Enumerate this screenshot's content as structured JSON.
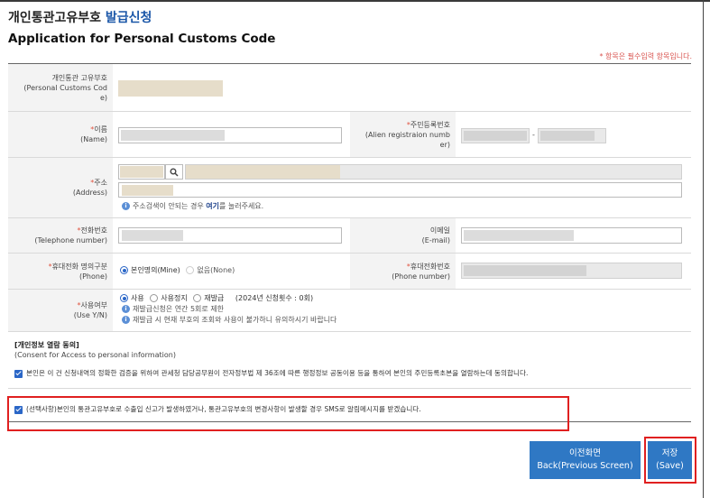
{
  "header": {
    "title_ko_plain": "개인통관고유부호",
    "title_ko_accent": "발급신청",
    "title_en": "Application for Personal Customs Code"
  },
  "required_note": "* 항목은 필수입력 항목입니다.",
  "form": {
    "customs_code": {
      "label_ko": "개인통관 고유부호",
      "label_en_1": "(Personal Customs Cod",
      "label_en_2": "e)"
    },
    "name": {
      "label_ko": "이름",
      "label_en": "(Name)"
    },
    "registration": {
      "label_ko": "주민등록번호",
      "label_en_1": "(Alien registraion numb",
      "label_en_2": "er)",
      "separator": "-"
    },
    "address": {
      "label_ko": "주소",
      "label_en": "(Address)",
      "note_text": "주소검색이 안되는 경우 ",
      "note_link": "여기",
      "note_suffix": "를 눌러주세요."
    },
    "telephone": {
      "label_ko": "전화번호",
      "label_en": "(Telephone number)"
    },
    "email": {
      "label_ko": "이메일",
      "label_en": "(E-mail)"
    },
    "phone_owner": {
      "label_ko": "휴대전화 명의구분",
      "label_en": "(Phone)",
      "option_1": "본인명의(Mine)",
      "option_2": "없음(None)",
      "selected": "본인명의(Mine)"
    },
    "mobile": {
      "label_ko": "휴대전화번호",
      "label_en": "(Phone number)"
    },
    "use_status": {
      "label_ko": "사용여부",
      "label_en": "(Use Y/N)",
      "option_1": "사용",
      "option_2": "사용정지",
      "option_3": "재발급",
      "count_text": "(2024년 신청횟수 : 0회)",
      "note_1": "재발급신청은 연간 5회로 제한",
      "note_2": "재발급 시 현재 부호의 조회와 사용이 불가하니 유의하시기 바랍니다",
      "selected": "사용"
    }
  },
  "consent": {
    "heading": "[개인정보 열람 동의]",
    "heading_en": "(Consent for Access to personal information)",
    "item_1": "본인은 이 건 신청내역의 정확한 검증을 위하여 관세청 담당공무원이 전자정부법 제 36조에 따른 행정정보 공동이용 등을 통하여 본인의 주민등록초본을 열람하는데 동의합니다.",
    "item_2": "(선택사항)본인의 통관고유부호로 수출입 신고가 발생하였거나, 통관고유부호의 변경사항이 발생할 경우 SMS로 알림메시지를 받겠습니다."
  },
  "buttons": {
    "back_ko": "이전화면",
    "back_en": "Back(Previous Screen)",
    "save_ko": "저장",
    "save_en": "(Save)"
  },
  "colors": {
    "accent": "#1a56a8",
    "button": "#2f78c4",
    "required": "#e0533f",
    "highlight": "#e02020"
  }
}
